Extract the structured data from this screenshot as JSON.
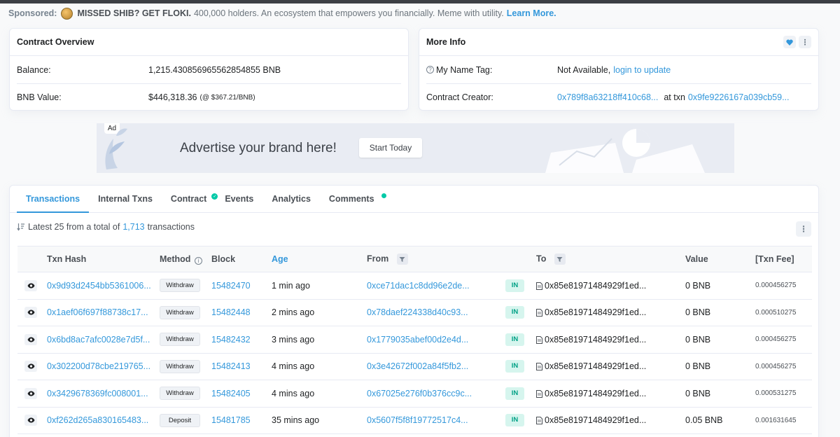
{
  "sponsored": {
    "label": "Sponsored:",
    "headline": "MISSED SHIB? GET FLOKI.",
    "text": "400,000 holders. An ecosystem that empowers you financially. Meme with utility.",
    "link": "Learn More."
  },
  "overview": {
    "title": "Contract Overview",
    "balance_label": "Balance:",
    "balance_value": "1,215.430856965562854855 BNB",
    "bnb_value_label": "BNB Value:",
    "bnb_value": "$446,318.36",
    "bnb_rate": "(@ $367.21/BNB)"
  },
  "more_info": {
    "title": "More Info",
    "name_tag_label": "My Name Tag:",
    "name_tag_value": "Not Available,",
    "name_tag_link": "login to update",
    "creator_label": "Contract Creator:",
    "creator_address": "0x789f8a63218ff410c68...",
    "at_txn": "at txn",
    "creator_txn": "0x9fe9226167a039cb59..."
  },
  "ad": {
    "tag": "Ad",
    "headline": "Advertise your brand here!",
    "button": "Start Today"
  },
  "tabs": [
    {
      "label": "Transactions",
      "active": true
    },
    {
      "label": "Internal Txns"
    },
    {
      "label": "Contract"
    },
    {
      "label": "Events"
    },
    {
      "label": "Analytics"
    },
    {
      "label": "Comments"
    }
  ],
  "summary": {
    "prefix": "Latest 25 from a total of",
    "count": "1,713",
    "suffix": "transactions"
  },
  "table": {
    "headers": [
      "Txn Hash",
      "Method",
      "Block",
      "Age",
      "From",
      "To",
      "Value",
      "[Txn Fee]"
    ],
    "rows": [
      {
        "hash": "0x9d93d2454bb5361006...",
        "method": "Withdraw",
        "block": "15482470",
        "age": "1 min ago",
        "from": "0xce71dac1c8dd96e2de...",
        "dir": "IN",
        "to": "0x85e81971484929f1ed...",
        "value": "0 BNB",
        "fee": "0.000456275"
      },
      {
        "hash": "0x1aef06f697f88738c17...",
        "method": "Withdraw",
        "block": "15482448",
        "age": "2 mins ago",
        "from": "0x78daef224338d40c93...",
        "dir": "IN",
        "to": "0x85e81971484929f1ed...",
        "value": "0 BNB",
        "fee": "0.000510275"
      },
      {
        "hash": "0x6bd8ac7afc0028e7d5f...",
        "method": "Withdraw",
        "block": "15482432",
        "age": "3 mins ago",
        "from": "0x1779035abef00d2e4d...",
        "dir": "IN",
        "to": "0x85e81971484929f1ed...",
        "value": "0 BNB",
        "fee": "0.000456275"
      },
      {
        "hash": "0x302200d78cbe219765...",
        "method": "Withdraw",
        "block": "15482413",
        "age": "4 mins ago",
        "from": "0x3e42672f002a84f5fb2...",
        "dir": "IN",
        "to": "0x85e81971484929f1ed...",
        "value": "0 BNB",
        "fee": "0.000456275"
      },
      {
        "hash": "0x3429678369fc008001...",
        "method": "Withdraw",
        "block": "15482405",
        "age": "4 mins ago",
        "from": "0x67025e276f0b376cc9c...",
        "dir": "IN",
        "to": "0x85e81971484929f1ed...",
        "value": "0 BNB",
        "fee": "0.000531275"
      },
      {
        "hash": "0xf262d265a830165483...",
        "method": "Deposit",
        "block": "15481785",
        "age": "35 mins ago",
        "from": "0x5607f5f8f19772517c4...",
        "dir": "IN",
        "to": "0x85e81971484929f1ed...",
        "value": "0.05 BNB",
        "fee": "0.001631645"
      }
    ]
  }
}
